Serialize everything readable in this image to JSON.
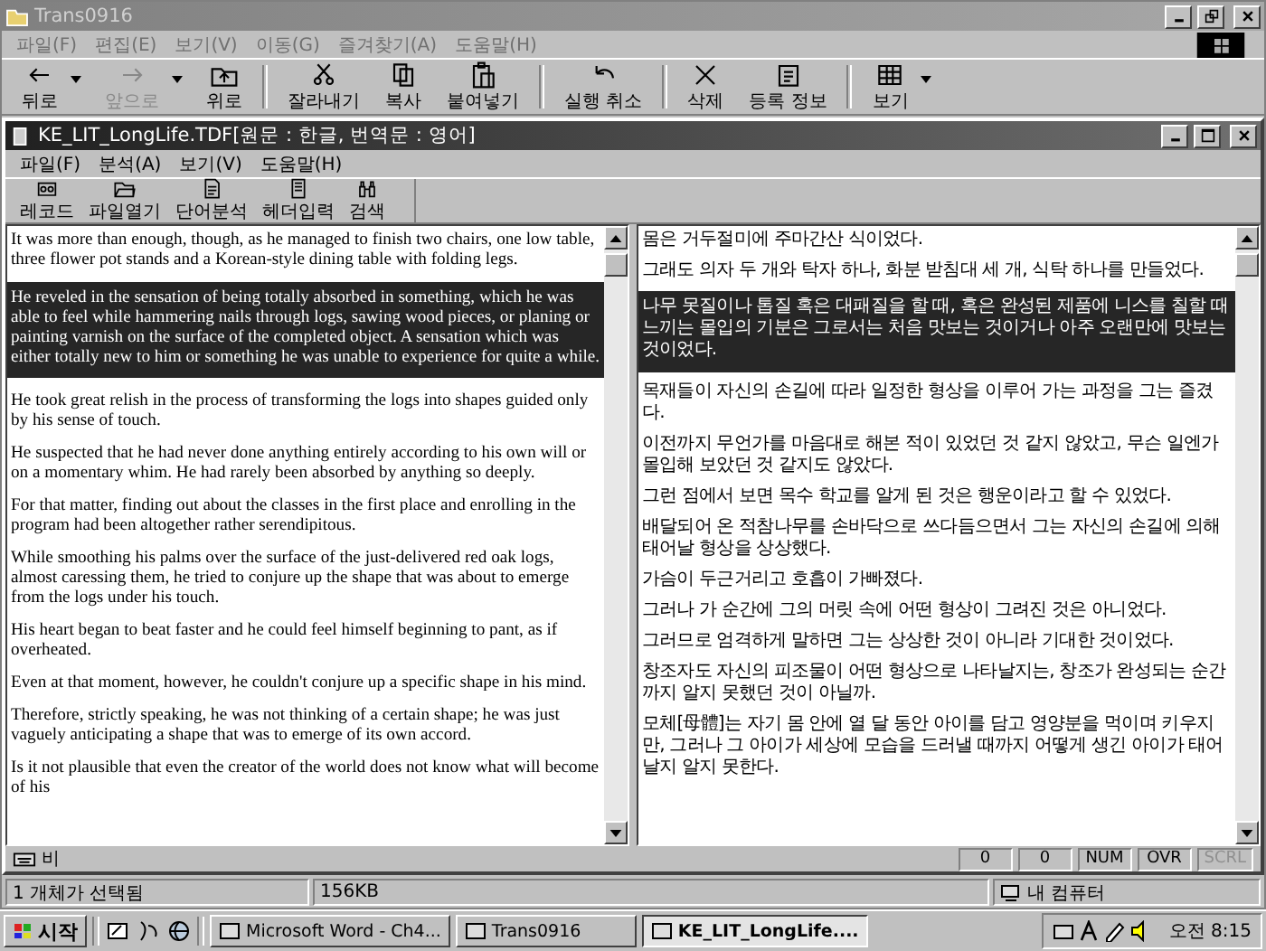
{
  "outer_window": {
    "title": "Trans0916",
    "active": false,
    "menu": [
      "파일(F)",
      "편집(E)",
      "보기(V)",
      "이동(G)",
      "즐겨찾기(A)",
      "도움말(H)"
    ],
    "toolbar": [
      [
        {
          "label": "뒤로",
          "dropdown": true,
          "disabled": false
        },
        {
          "label": "앞으로",
          "dropdown": true,
          "disabled": true
        },
        {
          "label": "위로",
          "dropdown": false,
          "disabled": false
        }
      ],
      [
        {
          "label": "잘라내기",
          "dropdown": false,
          "disabled": false
        },
        {
          "label": "복사",
          "dropdown": false,
          "disabled": false
        },
        {
          "label": "붙여넣기",
          "dropdown": false,
          "disabled": false
        }
      ],
      [
        {
          "label": "실행 취소",
          "dropdown": false,
          "disabled": false
        }
      ],
      [
        {
          "label": "삭제",
          "dropdown": false,
          "disabled": false
        },
        {
          "label": "등록 정보",
          "dropdown": false,
          "disabled": false
        }
      ],
      [
        {
          "label": "보기",
          "dropdown": true,
          "disabled": false
        }
      ]
    ],
    "status_bar": [
      "1 개체가 선택됨",
      "156KB",
      "내 컴퓨터"
    ]
  },
  "document_window": {
    "title": "KE_LIT_LongLife.TDF[원문 : 한글, 번역문 : 영어]",
    "active": true,
    "menu": [
      "파일(F)",
      "분석(A)",
      "보기(V)",
      "도움말(H)"
    ],
    "toolbar": [
      "레코드",
      "파일열기",
      "단어분석",
      "헤더입력",
      "검색"
    ],
    "left_pane": [
      {
        "text": "It was more than enough, though, as he managed to finish two chairs, one low table, three flower pot stands and a Korean-style dining table with folding legs.",
        "selected": false
      },
      {
        "text": "He reveled in the sensation of being totally absorbed in something, which he was able to feel while hammering nails through logs, sawing wood pieces, or planing or painting varnish on the surface of the completed object. A sensation which was either totally new to him or something he was unable to experience for quite a while.",
        "selected": true
      },
      {
        "text": "He took great relish in the process of transforming the logs into shapes guided only by his sense of touch.",
        "selected": false
      },
      {
        "text": "He suspected that he had never done anything entirely according to his own will or on a momentary whim. He had rarely been absorbed by anything so deeply.",
        "selected": false
      },
      {
        "text": "For that matter, finding out about the classes in the first place and enrolling in the program had been altogether rather serendipitous.",
        "selected": false
      },
      {
        "text": "While smoothing his palms over the surface of the just-delivered red oak logs, almost caressing them, he tried to conjure up the shape that was about to emerge from the logs under his touch.",
        "selected": false
      },
      {
        "text": "His heart began to beat faster and he could feel himself beginning to pant, as if overheated.",
        "selected": false
      },
      {
        "text": "Even at that moment, however, he couldn't conjure up a specific shape in his mind.",
        "selected": false
      },
      {
        "text": "Therefore, strictly speaking, he was not thinking of a certain shape; he was just vaguely anticipating a shape that was to emerge of its own accord.",
        "selected": false
      },
      {
        "text": "Is it not plausible that even the creator of the world does not know what will become of his",
        "selected": false
      }
    ],
    "right_pane": [
      {
        "text": "몸은 거두절미에 주마간산 식이었다.",
        "selected": false
      },
      {
        "text": "그래도 의자 두 개와 탁자 하나, 화분 받침대 세 개, 식탁 하나를 만들었다.",
        "selected": false
      },
      {
        "text": "나무 못질이나 톱질 혹은 대패질을 할 때, 혹은 완성된 제품에 니스를 칠할 때 느끼는 몰입의 기분은 그로서는 처음 맛보는 것이거나 아주 오랜만에 맛보는 것이었다.",
        "selected": true
      },
      {
        "text": "목재들이 자신의 손길에 따라 일정한 형상을 이루어 가는 과정을 그는 즐겼다.",
        "selected": false
      },
      {
        "text": "이전까지 무언가를 마음대로 해본 적이 있었던 것 같지 않았고, 무슨 일엔가 몰입해 보았던 것 같지도 않았다.",
        "selected": false
      },
      {
        "text": "그런 점에서 보면 목수 학교를 알게 된 것은 행운이라고 할 수 있었다.",
        "selected": false
      },
      {
        "text": "배달되어 온 적참나무를 손바닥으로 쓰다듬으면서 그는 자신의 손길에 의해 태어날 형상을 상상했다.",
        "selected": false
      },
      {
        "text": "가슴이 두근거리고 호흡이 가빠졌다.",
        "selected": false
      },
      {
        "text": "그러나 가 순간에 그의 머릿 속에 어떤 형상이 그려진 것은 아니었다.",
        "selected": false
      },
      {
        "text": "그러므로 엄격하게 말하면 그는 상상한 것이 아니라 기대한 것이었다.",
        "selected": false
      },
      {
        "text": "창조자도 자신의 피조물이 어떤 형상으로 나타날지는, 창조가 완성되는 순간까지 알지 못했던 것이 아닐까.",
        "selected": false
      },
      {
        "text": "모체[母體]는 자기 몸 안에 열 달 동안 아이를 담고 영양분을 먹이며 키우지만, 그러나 그 아이가 세상에 모습을 드러낼 때까지 어떻게 생긴 아이가 태어날지 알지 못한다.",
        "selected": false
      }
    ],
    "status_bar": {
      "mode": "비",
      "indicators": [
        {
          "text": "0",
          "disabled": false
        },
        {
          "text": "0",
          "disabled": false
        },
        {
          "text": "NUM",
          "disabled": false
        },
        {
          "text": "OVR",
          "disabled": false
        },
        {
          "text": "SCRL",
          "disabled": true
        }
      ]
    }
  },
  "taskbar": {
    "start": "시작",
    "tasks": [
      {
        "label": "Microsoft Word - Ch4...",
        "selected": false
      },
      {
        "label": "Trans0916",
        "selected": false
      },
      {
        "label": "KE_LIT_LongLife....",
        "selected": true
      }
    ],
    "clock": "오전 8:15"
  }
}
